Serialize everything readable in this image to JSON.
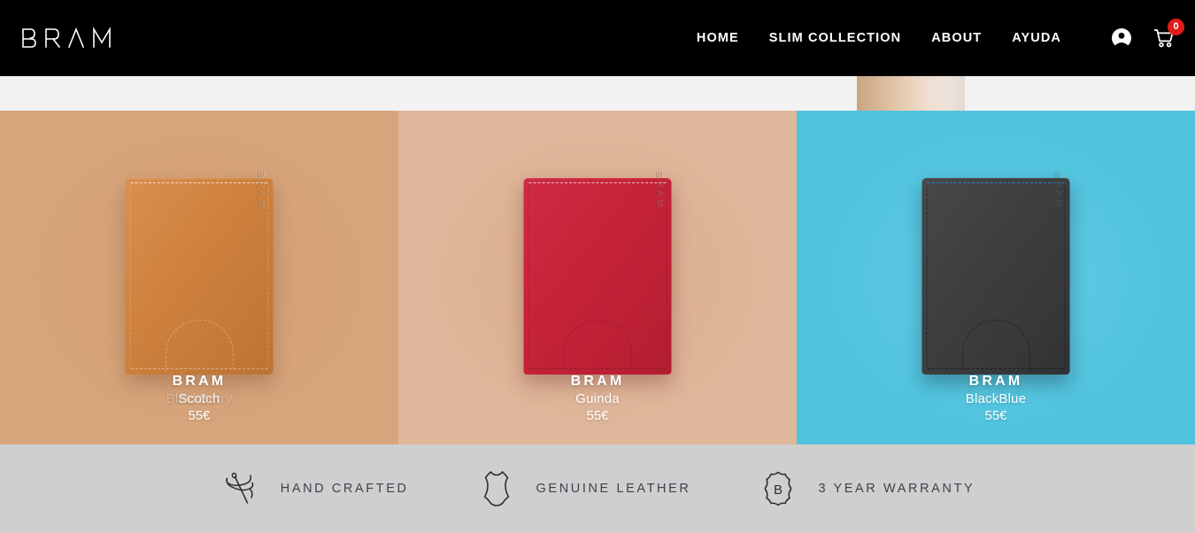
{
  "header": {
    "logo_text": "BRAM",
    "nav": [
      {
        "label": "HOME",
        "name": "nav-home"
      },
      {
        "label": "SLIM COLLECTION",
        "name": "nav-slim-collection"
      },
      {
        "label": "ABOUT",
        "name": "nav-about"
      },
      {
        "label": "AYUDA",
        "name": "nav-ayuda"
      }
    ],
    "account_icon": "account-circle-icon",
    "cart_icon": "shopping-cart-icon",
    "cart_count": "0",
    "cart_badge_color": "#e01b1b",
    "background_color": "#000000"
  },
  "hero_strip": {
    "background_color": "#f2f2f2"
  },
  "products": [
    {
      "brand": "BRAM",
      "name": "Scotch",
      "price": "55€",
      "ghost_name": "BlackBerry",
      "background_color": "#d7a57c",
      "wallet_color": "#d0833f",
      "emboss_text": "BRAM"
    },
    {
      "brand": "BRAM",
      "name": "Guinda",
      "price": "55€",
      "ghost_name": "",
      "background_color": "#dfb79a",
      "wallet_color": "#c72339",
      "emboss_text": "BRAM"
    },
    {
      "brand": "BRAM",
      "name": "BlackBlue",
      "price": "55€",
      "ghost_name": "",
      "background_color": "#4fc3de",
      "wallet_color": "#3e3f41",
      "emboss_text": "BRAM"
    }
  ],
  "features": {
    "background_color": "#cfcfcf",
    "text_color": "#3c4450",
    "items": [
      {
        "label": "HAND CRAFTED",
        "icon": "needle-thread-icon"
      },
      {
        "label": "GENUINE LEATHER",
        "icon": "leather-hide-icon"
      },
      {
        "label": "3 YEAR WARRANTY",
        "icon": "warranty-seal-icon",
        "seal_letter": "B"
      }
    ]
  }
}
